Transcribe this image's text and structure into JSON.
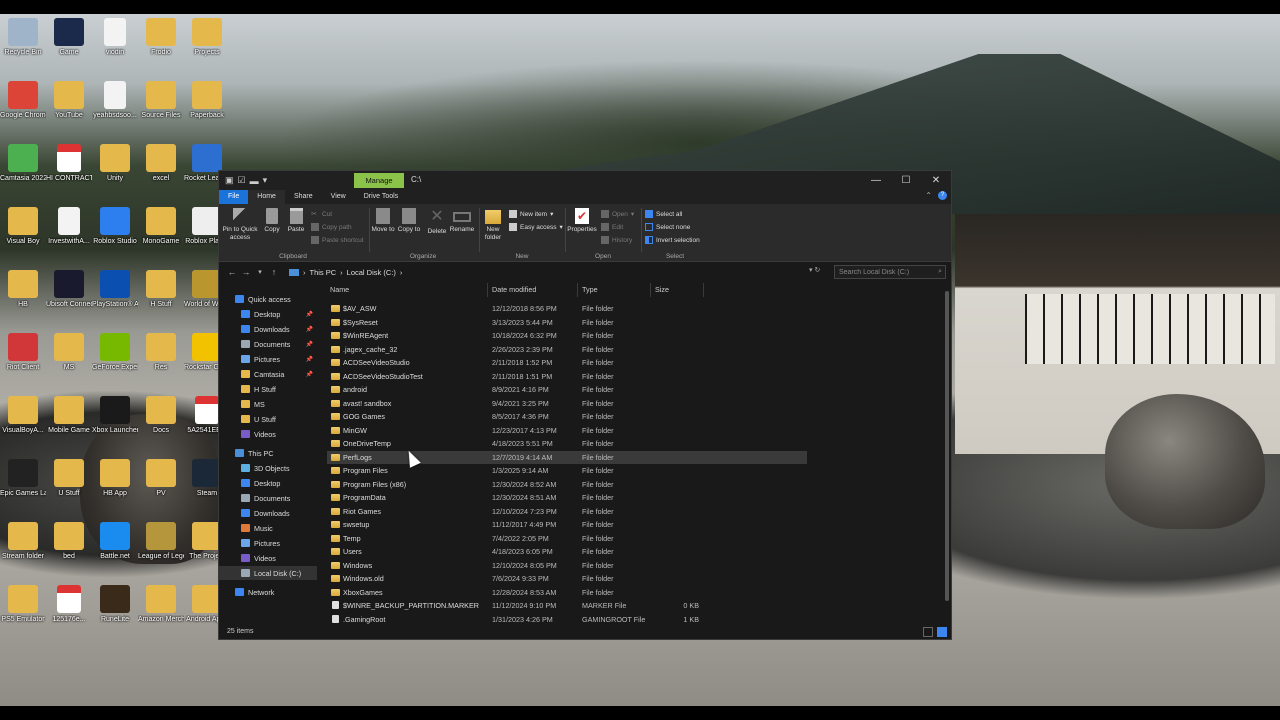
{
  "desktop": {
    "icons": [
      {
        "label": "Recycle Bin",
        "kind": "app",
        "color": "#9fb4c8"
      },
      {
        "label": "Game",
        "kind": "app",
        "color": "#1b2a4a"
      },
      {
        "label": "viodin",
        "kind": "doc",
        "color": "#f3f3f3"
      },
      {
        "label": "Frodio",
        "kind": "folder",
        "color": "#e5b84c"
      },
      {
        "label": "Projects",
        "kind": "folder",
        "color": "#e5b84c"
      },
      {
        "label": "Google Chrome",
        "kind": "app",
        "color": "#db4437"
      },
      {
        "label": "YouTube",
        "kind": "folder",
        "color": "#e5b84c"
      },
      {
        "label": "yeahbsdsoo...",
        "kind": "doc",
        "color": "#f3f3f3"
      },
      {
        "label": "Source Files",
        "kind": "folder",
        "color": "#e5b84c"
      },
      {
        "label": "Paperback",
        "kind": "folder",
        "color": "#e5b84c"
      },
      {
        "label": "Camtasia 2022",
        "kind": "app",
        "color": "#4caf50"
      },
      {
        "label": "HI CONTRACT",
        "kind": "pdf",
        "color": "#d33"
      },
      {
        "label": "Unity",
        "kind": "folder",
        "color": "#e5b84c"
      },
      {
        "label": "excel",
        "kind": "folder",
        "color": "#e5b84c"
      },
      {
        "label": "Rocket League",
        "kind": "app",
        "color": "#2d6fd1"
      },
      {
        "label": "Visual Boy",
        "kind": "folder",
        "color": "#e5b84c"
      },
      {
        "label": "InvestwithA...",
        "kind": "doc",
        "color": "#f3f3f3"
      },
      {
        "label": "Roblox Studio",
        "kind": "app",
        "color": "#2d7ff0"
      },
      {
        "label": "MonoGame",
        "kind": "folder",
        "color": "#e5b84c"
      },
      {
        "label": "Roblox Player",
        "kind": "app",
        "color": "#eeeeee"
      },
      {
        "label": "HB",
        "kind": "folder",
        "color": "#e5b84c"
      },
      {
        "label": "Ubisoft Connect",
        "kind": "app",
        "color": "#1a1a2e"
      },
      {
        "label": "PlayStation® Accessories",
        "kind": "app",
        "color": "#0b4fb0"
      },
      {
        "label": "H Stuff",
        "kind": "folder",
        "color": "#e5b84c"
      },
      {
        "label": "World of Warcra...",
        "kind": "app",
        "color": "#b9962e"
      },
      {
        "label": "Riot Client",
        "kind": "app",
        "color": "#d13639"
      },
      {
        "label": "MS",
        "kind": "folder",
        "color": "#e5b84c"
      },
      {
        "label": "GeForce Experience",
        "kind": "app",
        "color": "#76b900"
      },
      {
        "label": "Res",
        "kind": "folder",
        "color": "#e5b84c"
      },
      {
        "label": "Rockstar Games",
        "kind": "app",
        "color": "#f2c200"
      },
      {
        "label": "VisualBoyA...",
        "kind": "folder",
        "color": "#e5b84c"
      },
      {
        "label": "Mobile Game",
        "kind": "folder",
        "color": "#e5b84c"
      },
      {
        "label": "Xbox Launcher",
        "kind": "app",
        "color": "#1a1a1a"
      },
      {
        "label": "Docs",
        "kind": "folder",
        "color": "#e5b84c"
      },
      {
        "label": "5A2541EE...",
        "kind": "pdf",
        "color": "#d33"
      },
      {
        "label": "Epic Games Launcher",
        "kind": "app",
        "color": "#222222"
      },
      {
        "label": "U Stuff",
        "kind": "folder",
        "color": "#e5b84c"
      },
      {
        "label": "HB App",
        "kind": "folder",
        "color": "#e5b84c"
      },
      {
        "label": "PV",
        "kind": "folder",
        "color": "#e5b84c"
      },
      {
        "label": "Steam",
        "kind": "app",
        "color": "#1b2838"
      },
      {
        "label": "Stream folder",
        "kind": "folder",
        "color": "#e5b84c"
      },
      {
        "label": "bed",
        "kind": "folder",
        "color": "#e5b84c"
      },
      {
        "label": "Battle.net",
        "kind": "app",
        "color": "#1a8cf0"
      },
      {
        "label": "League of Legends",
        "kind": "app",
        "color": "#b6963c"
      },
      {
        "label": "The Project",
        "kind": "folder",
        "color": "#e5b84c"
      },
      {
        "label": "PS5 Emulator",
        "kind": "folder",
        "color": "#e5b84c"
      },
      {
        "label": "125176e...",
        "kind": "pdf",
        "color": "#d33"
      },
      {
        "label": "RuneLite",
        "kind": "app",
        "color": "#3a2a1a"
      },
      {
        "label": "Amazon Merch",
        "kind": "folder",
        "color": "#e5b84c"
      },
      {
        "label": "Android Apps",
        "kind": "folder",
        "color": "#e5b84c"
      }
    ]
  },
  "window": {
    "manage_tab": "Manage",
    "title_path": "C:\\",
    "min": "—",
    "max": "☐",
    "close": "✕"
  },
  "ribbon_tabs": {
    "file": "File",
    "home": "Home",
    "share": "Share",
    "view": "View",
    "drive_tools": "Drive Tools"
  },
  "ribbon": {
    "pin_to_quick_access": "Pin to Quick access",
    "copy": "Copy",
    "paste": "Paste",
    "cut": "Cut",
    "copy_path": "Copy path",
    "paste_shortcut": "Paste shortcut",
    "clipboard_label": "Clipboard",
    "move_to": "Move to",
    "copy_to": "Copy to",
    "delete": "Delete",
    "rename": "Rename",
    "organize_label": "Organize",
    "new_folder": "New folder",
    "new_item": "New item",
    "easy_access": "Easy access",
    "new_label": "New",
    "properties": "Properties",
    "open": "Open",
    "edit": "Edit",
    "history": "History",
    "open_label": "Open",
    "select_all": "Select all",
    "select_none": "Select none",
    "invert_selection": "Invert selection",
    "select_label": "Select"
  },
  "address": {
    "crumbs": [
      "This PC",
      "Local Disk (C:)"
    ],
    "search_placeholder": "Search Local Disk (C:)"
  },
  "nav_pane": {
    "quick_access": "Quick access",
    "quick_items": [
      "Desktop",
      "Downloads",
      "Documents",
      "Pictures",
      "Camtasia",
      "H Stuff",
      "MS",
      "U Stuff",
      "Videos"
    ],
    "this_pc": "This PC",
    "pc_items": [
      "3D Objects",
      "Desktop",
      "Documents",
      "Downloads",
      "Music",
      "Pictures",
      "Videos",
      "Local Disk (C:)"
    ],
    "network": "Network"
  },
  "columns": {
    "name": "Name",
    "date_modified": "Date modified",
    "type": "Type",
    "size": "Size"
  },
  "files": [
    {
      "name": "$AV_ASW",
      "date": "12/12/2018 8:56 PM",
      "type": "File folder",
      "size": ""
    },
    {
      "name": "$SysReset",
      "date": "3/13/2023 5:44 PM",
      "type": "File folder",
      "size": ""
    },
    {
      "name": "$WinREAgent",
      "date": "10/18/2024 6:32 PM",
      "type": "File folder",
      "size": ""
    },
    {
      "name": ".jagex_cache_32",
      "date": "2/26/2023 2:39 PM",
      "type": "File folder",
      "size": ""
    },
    {
      "name": "ACDSeeVideoStudio",
      "date": "2/11/2018 1:52 PM",
      "type": "File folder",
      "size": ""
    },
    {
      "name": "ACDSeeVideoStudioTest",
      "date": "2/11/2018 1:51 PM",
      "type": "File folder",
      "size": ""
    },
    {
      "name": "android",
      "date": "8/9/2021 4:16 PM",
      "type": "File folder",
      "size": ""
    },
    {
      "name": "avast! sandbox",
      "date": "9/4/2021 3:25 PM",
      "type": "File folder",
      "size": ""
    },
    {
      "name": "GOG Games",
      "date": "8/5/2017 4:36 PM",
      "type": "File folder",
      "size": ""
    },
    {
      "name": "MinGW",
      "date": "12/23/2017 4:13 PM",
      "type": "File folder",
      "size": ""
    },
    {
      "name": "OneDriveTemp",
      "date": "4/18/2023 5:51 PM",
      "type": "File folder",
      "size": ""
    },
    {
      "name": "PerfLogs",
      "date": "12/7/2019 4:14 AM",
      "type": "File folder",
      "size": ""
    },
    {
      "name": "Program Files",
      "date": "1/3/2025 9:14 AM",
      "type": "File folder",
      "size": ""
    },
    {
      "name": "Program Files (x86)",
      "date": "12/30/2024 8:52 AM",
      "type": "File folder",
      "size": ""
    },
    {
      "name": "ProgramData",
      "date": "12/30/2024 8:51 AM",
      "type": "File folder",
      "size": ""
    },
    {
      "name": "Riot Games",
      "date": "12/10/2024 7:23 PM",
      "type": "File folder",
      "size": ""
    },
    {
      "name": "swsetup",
      "date": "11/12/2017 4:49 PM",
      "type": "File folder",
      "size": ""
    },
    {
      "name": "Temp",
      "date": "7/4/2022 2:05 PM",
      "type": "File folder",
      "size": ""
    },
    {
      "name": "Users",
      "date": "4/18/2023 6:05 PM",
      "type": "File folder",
      "size": ""
    },
    {
      "name": "Windows",
      "date": "12/10/2024 8:05 PM",
      "type": "File folder",
      "size": ""
    },
    {
      "name": "Windows.old",
      "date": "7/6/2024 9:33 PM",
      "type": "File folder",
      "size": ""
    },
    {
      "name": "XboxGames",
      "date": "12/28/2024 8:53 AM",
      "type": "File folder",
      "size": ""
    },
    {
      "name": "$WINRE_BACKUP_PARTITION.MARKER",
      "date": "11/12/2024 9:10 PM",
      "type": "MARKER File",
      "size": "0 KB"
    },
    {
      "name": ".GamingRoot",
      "date": "1/31/2023 4:26 PM",
      "type": "GAMINGROOT File",
      "size": "1 KB"
    }
  ],
  "hovered_file": "PerfLogs",
  "status": {
    "item_count": "25 items"
  },
  "colors": {
    "file_tab": "#1a73d9",
    "manage_tab": "#8bc34a",
    "explorer_bg": "#191919",
    "ribbon_bg": "#2b2b2b"
  }
}
